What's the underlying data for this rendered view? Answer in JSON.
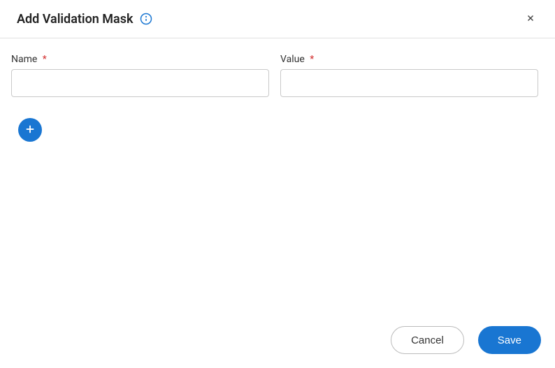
{
  "dialog": {
    "title": "Add Validation Mask"
  },
  "fields": {
    "name": {
      "label": "Name",
      "required": "*",
      "value": ""
    },
    "value": {
      "label": "Value",
      "required": "*",
      "value": ""
    }
  },
  "footer": {
    "cancel": "Cancel",
    "save": "Save"
  }
}
